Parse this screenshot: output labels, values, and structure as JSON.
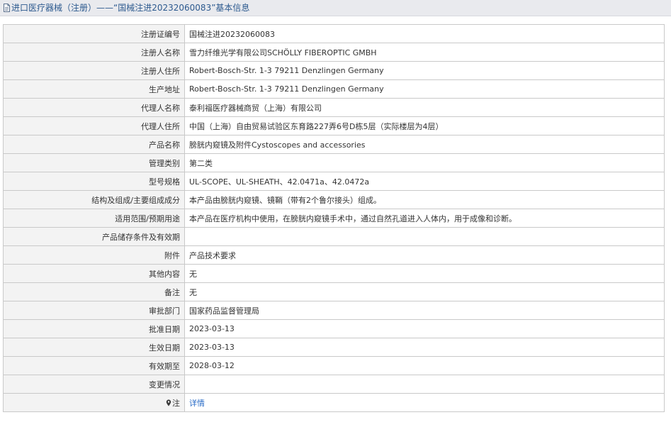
{
  "header": {
    "title": "进口医疗器械（注册）——“国械注进20232060083”基本信息",
    "icon": "document-icon"
  },
  "rows": [
    {
      "label": "注册证编号",
      "value": "国械注进20232060083"
    },
    {
      "label": "注册人名称",
      "value": "雪力纤维光学有限公司SCHÖLLY FIBEROPTIC GMBH"
    },
    {
      "label": "注册人住所",
      "value": "Robert-Bosch-Str. 1-3 79211 Denzlingen Germany"
    },
    {
      "label": "生产地址",
      "value": "Robert-Bosch-Str. 1-3 79211 Denzlingen Germany"
    },
    {
      "label": "代理人名称",
      "value": "泰利福医疗器械商贸（上海）有限公司"
    },
    {
      "label": "代理人住所",
      "value": "中国（上海）自由贸易试验区东育路227弄6号D栋5层（实际楼层为4层）"
    },
    {
      "label": "产品名称",
      "value": "膀胱内窥镜及附件Cystoscopes and accessories"
    },
    {
      "label": "管理类别",
      "value": "第二类"
    },
    {
      "label": "型号规格",
      "value": "UL-SCOPE、UL-SHEATH、42.0471a、42.0472a"
    },
    {
      "label": "结构及组成/主要组成成分",
      "value": "本产品由膀胱内窥镜、镜鞘（带有2个鲁尔接头）组成。"
    },
    {
      "label": "适用范围/预期用途",
      "value": "本产品在医疗机构中使用，在膀胱内窥镜手术中，通过自然孔道进入人体内，用于成像和诊断。"
    },
    {
      "label": "产品储存条件及有效期",
      "value": ""
    },
    {
      "label": "附件",
      "value": "产品技术要求"
    },
    {
      "label": "其他内容",
      "value": "无"
    },
    {
      "label": "备注",
      "value": "无"
    },
    {
      "label": "审批部门",
      "value": "国家药品监督管理局"
    },
    {
      "label": "批准日期",
      "value": "2023-03-13"
    },
    {
      "label": "生效日期",
      "value": "2023-03-13"
    },
    {
      "label": "有效期至",
      "value": "2028-03-12"
    },
    {
      "label": "变更情况",
      "value": ""
    }
  ],
  "note_row": {
    "label": "注",
    "icon": "pin-icon",
    "link_text": "详情",
    "link_color": "#2a6cc7"
  }
}
